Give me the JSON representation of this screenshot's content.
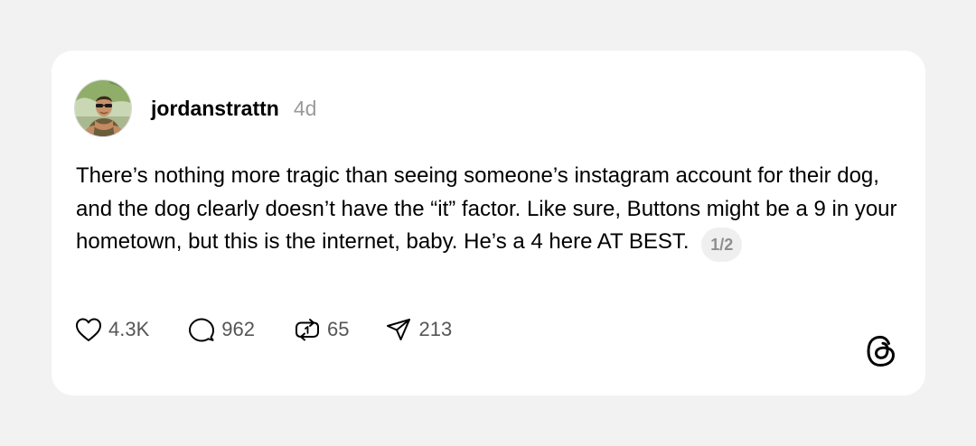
{
  "post": {
    "username": "jordanstrattn",
    "time_ago": "4d",
    "text": "There’s nothing more tragic than seeing someone’s instagram account for their dog, and the dog clearly doesn’t have the “it” factor. Like sure, Buttons might be a 9 in your hometown, but this is the internet, baby. He’s a 4 here AT BEST.",
    "page_indicator": "1/2"
  },
  "actions": {
    "likes": "4.3K",
    "replies": "962",
    "reposts": "65",
    "shares": "213"
  },
  "icons": {
    "like": "heart-icon",
    "reply": "comment-icon",
    "repost": "repost-icon",
    "share": "send-icon",
    "brand": "threads-logo-icon"
  },
  "colors": {
    "background": "#f2f2f2",
    "card": "#ffffff",
    "muted_text": "#9a9a9a",
    "badge_bg": "#efefef"
  }
}
